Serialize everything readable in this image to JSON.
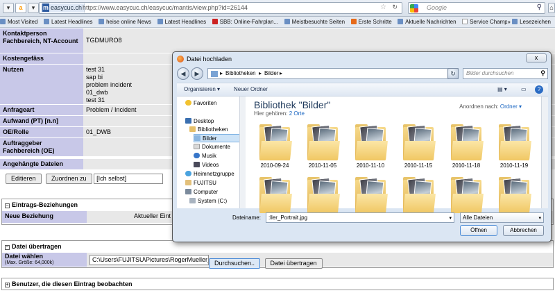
{
  "browser": {
    "site": "easycuc.ch",
    "url": "https://www.easycuc.ch/easycuc/mantis/view.php?id=26144",
    "search_placeholder": "Google",
    "bookmarks": [
      "Most Visited",
      "Latest Headlines",
      "heise online News",
      "Latest Headlines",
      "SBB: Online-Fahrplan...",
      "Meistbesuchte Seiten",
      "Erste Schritte",
      "Aktuelle Nachrichten",
      "Service Champion - P...",
      "Lesezeichen"
    ]
  },
  "fields": [
    {
      "label": "Kontaktperson Fachbereich, NT-Account",
      "value": "TGDMURO8"
    },
    {
      "label": "Kostengefäss",
      "value": ""
    },
    {
      "label": "Nutzen",
      "value": "test 31\nsap bi\nproblem incident\n01_dwb\ntest 31"
    },
    {
      "label": "Anfrageart",
      "value": "Problem / Incident"
    },
    {
      "label": "Aufwand (PT) [n.n]",
      "value": ""
    },
    {
      "label": "OE/Rolle",
      "value": "01_DWB"
    },
    {
      "label": "Auftraggeber Fachbereich (OE)",
      "value": ""
    },
    {
      "label": "Angehängte Dateien",
      "value": ""
    }
  ],
  "actions": {
    "edit": "Editieren",
    "assign": "Zuordnen zu",
    "self": "[Ich selbst]"
  },
  "sections": {
    "relations": {
      "title": "Eintrags-Beziehungen",
      "label": "Neue Beziehung",
      "value": "Aktueller Eint"
    },
    "upload": {
      "title": "Datei übertragen",
      "label": "Datei wählen",
      "sublabel": "(Max. Größe: 64,000k)",
      "path": "C:\\Users\\FUJITSU\\Pictures\\RogerMueller_P",
      "browse": "Durchsuchen..",
      "submit": "Datei übertragen"
    },
    "watchers": {
      "title": "Benutzer, die diesen Eintrag beobachten"
    }
  },
  "dialog": {
    "title": "Datei hochladen",
    "close": "x",
    "breadcrumb": [
      "Bibliotheken",
      "Bilder"
    ],
    "search_placeholder": "Bilder durchsuchen",
    "commands": {
      "organize": "Organisieren",
      "new_folder": "Neuer Ordner"
    },
    "nav": [
      "Favoriten",
      "Desktop",
      "Bibliotheken",
      "Bilder",
      "Dokumente",
      "Musik",
      "Videos",
      "Heimnetzgruppe",
      "FUJITSU",
      "Computer",
      "System (C:)"
    ],
    "library_title": "Bibliothek \"Bilder\"",
    "library_sub": "Hier gehören:",
    "library_link": "2 Orte",
    "arrange_label": "Anordnen nach:",
    "arrange_value": "Ordner",
    "folders": [
      "2010-09-24",
      "2010-11-05",
      "2010-11-10",
      "2010-11-15",
      "2010-11-18",
      "2010-11-19",
      "",
      "",
      "",
      "",
      "",
      ""
    ],
    "filename_label": "Dateiname:",
    "filename": ":ller_Portrait.jpg",
    "filetype": "Alle Dateien",
    "open": "Öffnen",
    "cancel": "Abbrechen"
  }
}
